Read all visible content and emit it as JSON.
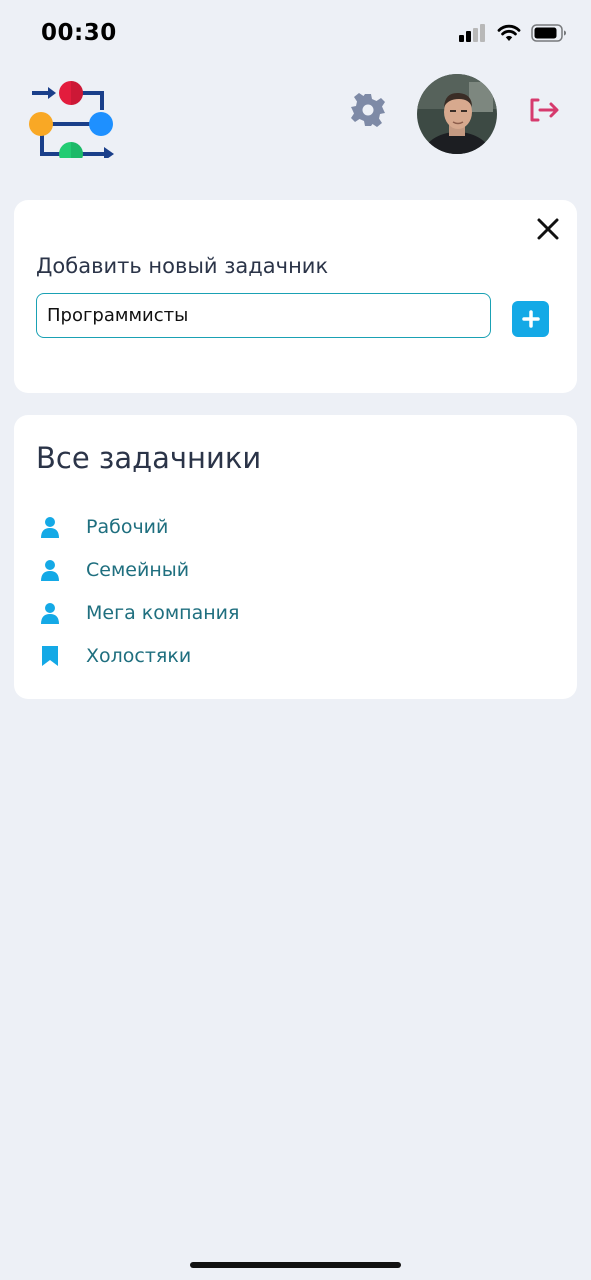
{
  "status_bar": {
    "time": "00:30"
  },
  "header": {
    "settings_icon": "gear-icon",
    "avatar_icon": "user-avatar",
    "logout_icon": "logout-icon",
    "accent_color": "#d63a6d"
  },
  "add_panel": {
    "title": "Добавить новый задачник",
    "input_value": "Программисты",
    "add_icon": "plus-icon",
    "close_icon": "close-icon"
  },
  "list_panel": {
    "title": "Все задачники",
    "items": [
      {
        "label": "Рабочий",
        "icon": "person-icon"
      },
      {
        "label": "Семейный",
        "icon": "person-icon"
      },
      {
        "label": "Мега компания",
        "icon": "person-icon"
      },
      {
        "label": "Холостяки",
        "icon": "bookmark-icon"
      }
    ]
  }
}
